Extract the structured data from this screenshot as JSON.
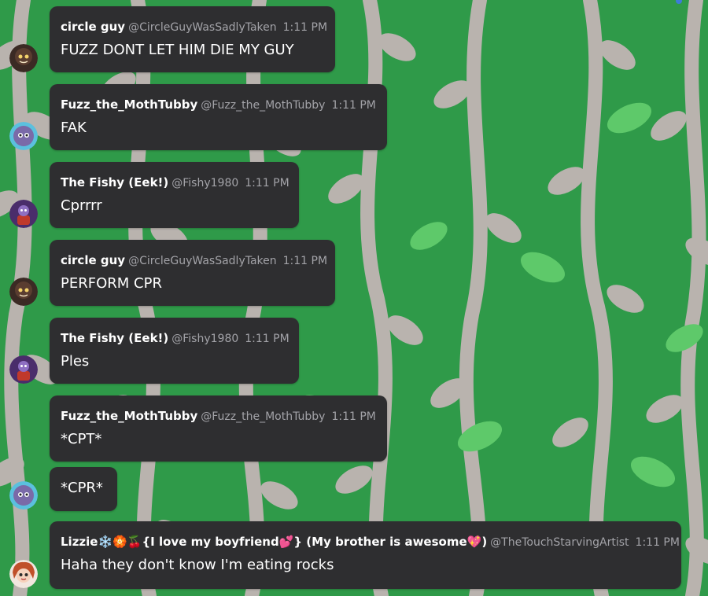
{
  "chat": {
    "messages": [
      {
        "user": "circle guy",
        "handle": "@CircleGuyWasSadlyTaken",
        "time": "1:11 PM",
        "text": "FUZZ DONT LET HIM DIE MY GUY",
        "avatar": "circle-guy-avatar"
      },
      {
        "user": "Fuzz_the_MothTubby",
        "handle": "@Fuzz_the_MothTubby",
        "time": "1:11 PM",
        "text": "FAK",
        "avatar": "moth-tubby-avatar"
      },
      {
        "user": "The Fishy (Eek!)",
        "handle": "@Fishy1980",
        "time": "1:11 PM",
        "text": "Cprrrr",
        "avatar": "fishy-avatar"
      },
      {
        "user": "circle guy",
        "handle": "@CircleGuyWasSadlyTaken",
        "time": "1:11 PM",
        "text": "PERFORM CPR",
        "avatar": "circle-guy-avatar"
      },
      {
        "user": "The Fishy (Eek!)",
        "handle": "@Fishy1980",
        "time": "1:11 PM",
        "text": "Ples",
        "avatar": "fishy-avatar"
      },
      {
        "user": "Fuzz_the_MothTubby",
        "handle": "@Fuzz_the_MothTubby",
        "time": "1:11 PM",
        "text": "*CPT*",
        "avatar": "moth-tubby-avatar"
      },
      {
        "text": "*CPR*",
        "avatar": "moth-tubby-avatar"
      },
      {
        "user": "Lizzie❄️🏵️🍒{I love my boyfriend💕} (My brother is awesome💖)",
        "handle": "@TheTouchStarvingArtist",
        "time": "1:11 PM",
        "text": "Haha they don't know I'm eating rocks",
        "avatar": "lizzie-avatar"
      }
    ]
  },
  "colors": {
    "background": "#2f9a49",
    "vine": "#b9b3ae",
    "leaf_light": "#5ec96a",
    "bubble": "#2e2e30",
    "text": "#ffffff",
    "muted": "#a3a3a8"
  }
}
